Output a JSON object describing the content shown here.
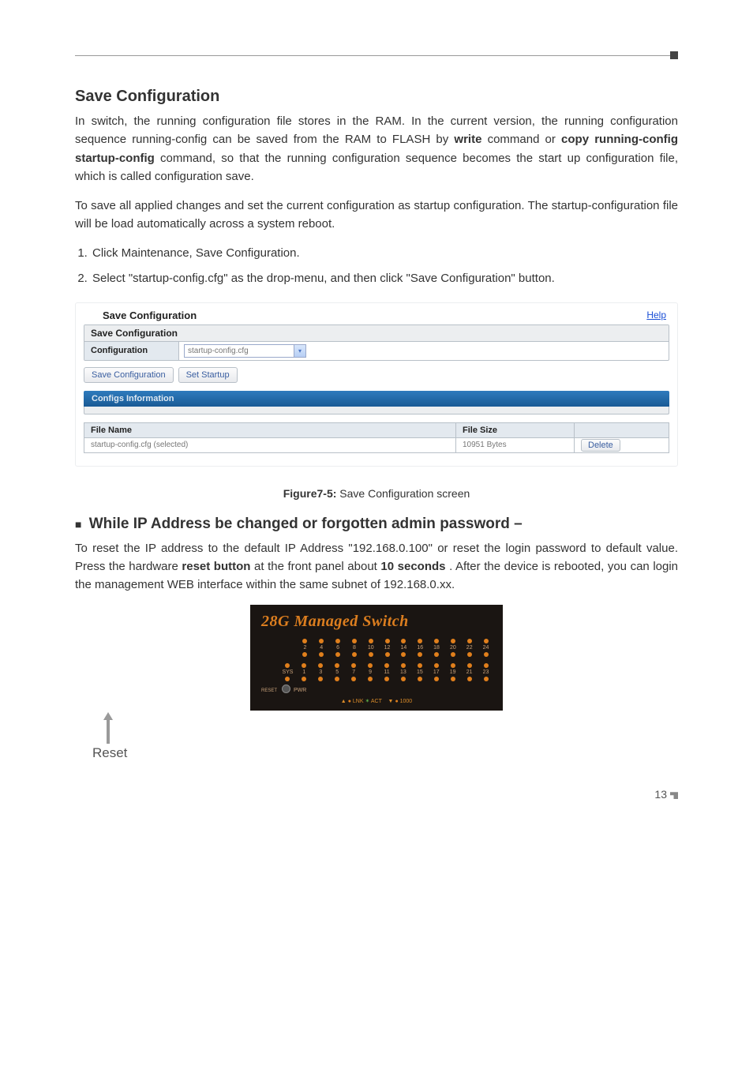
{
  "header_marker": "corner",
  "section1": {
    "title": "Save Configuration",
    "para1_a": "In switch, the running configuration file stores in the RAM. In the current version, the running configuration sequence running-config can be saved from the RAM to FLASH by ",
    "cmd1": "write",
    "para1_b": " command or ",
    "cmd2": "copy running-config startup-config",
    "para1_c": " command, so that the running configuration sequence becomes the start up configuration file, which is called configuration save.",
    "para2": "To save all applied changes and set the current configuration as startup configuration. The startup-configuration file will be load automatically across a system reboot.",
    "steps": [
      "Click Maintenance, Save Configuration.",
      "Select \"startup-config.cfg\" as the drop-menu, and then click \"Save Configuration\" button."
    ]
  },
  "panel": {
    "title": "Save Configuration",
    "help": "Help",
    "group_title": "Save Configuration",
    "config_label": "Configuration",
    "config_value": "startup-config.cfg",
    "btn_save": "Save Configuration",
    "btn_set": "Set Startup",
    "band_title": "Configs Information",
    "table": {
      "headers": [
        "File Name",
        "File Size"
      ],
      "row": {
        "name": "startup-config.cfg (selected)",
        "size": "10951 Bytes",
        "delete": "Delete"
      }
    }
  },
  "figure_caption_label": "Figure7-5:",
  "figure_caption_text": "  Save Configuration screen",
  "section2": {
    "bullet": "■",
    "title": " While IP Address be changed or forgotten admin password –",
    "para_a": "To reset the IP address to the default IP Address \"192.168.0.100\" or reset the login password to default value. Press the hardware ",
    "cmd1": "reset button",
    "para_b": " at the front panel about ",
    "cmd2": "10 seconds",
    "para_c": ". After the device is rebooted, you can login the management WEB interface within the same subnet of 192.168.0.xx."
  },
  "switch": {
    "title": "28G Managed Switch",
    "top_ports": [
      "2",
      "4",
      "6",
      "8",
      "10",
      "12",
      "14",
      "16",
      "18",
      "20",
      "22",
      "24"
    ],
    "sys_label": "SYS",
    "bottom_ports": [
      "1",
      "3",
      "5",
      "7",
      "9",
      "11",
      "13",
      "15",
      "17",
      "19",
      "21",
      "23"
    ],
    "reset_label": "RESET",
    "pwr_label": "PWR",
    "legend_lnk": "LNK",
    "legend_act": "ACT",
    "legend_1000": "1000",
    "reset_caption": "Reset"
  },
  "page_number": "13"
}
